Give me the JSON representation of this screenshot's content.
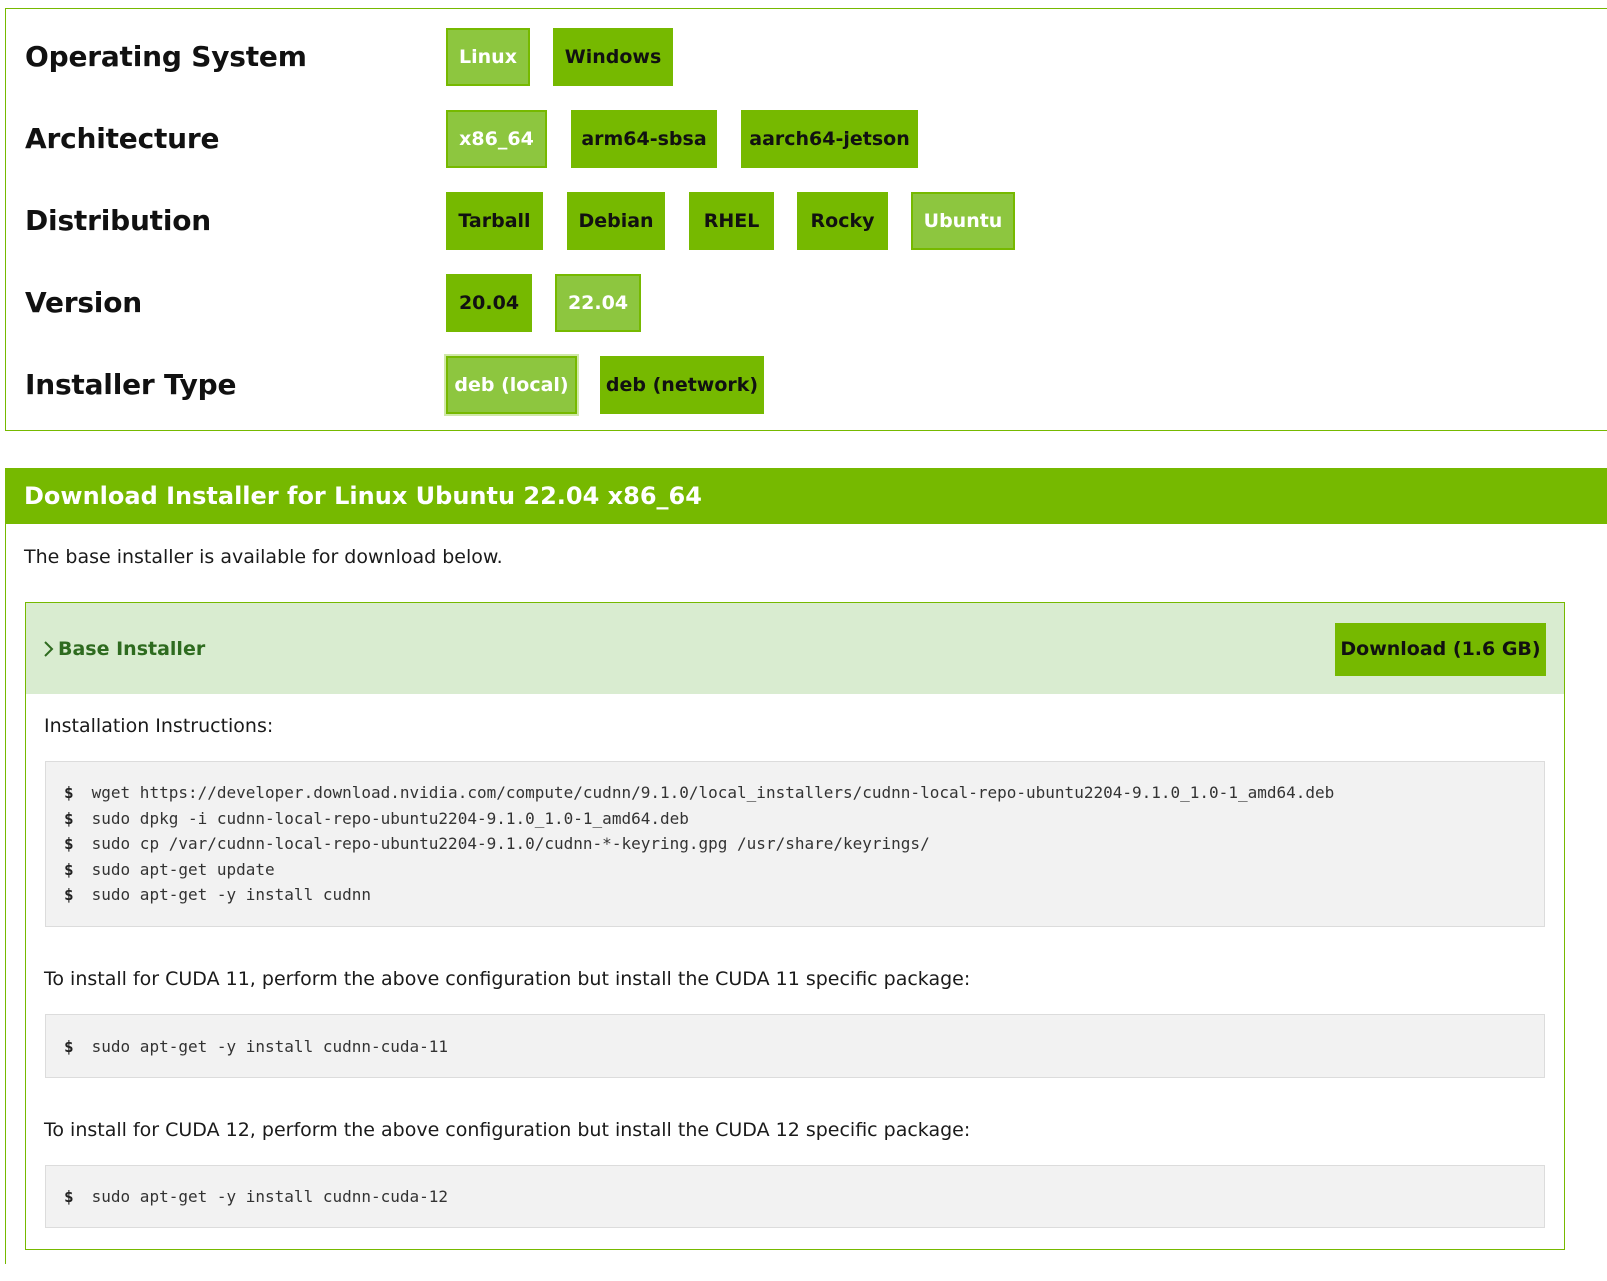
{
  "selector": {
    "rows": [
      {
        "label": "Operating System",
        "options": [
          {
            "label": "Linux",
            "selected": true
          },
          {
            "label": "Windows",
            "selected": false
          }
        ]
      },
      {
        "label": "Architecture",
        "options": [
          {
            "label": "x86_64",
            "selected": true
          },
          {
            "label": "arm64-sbsa",
            "selected": false
          },
          {
            "label": "aarch64-jetson",
            "selected": false
          }
        ]
      },
      {
        "label": "Distribution",
        "options": [
          {
            "label": "Tarball",
            "selected": false
          },
          {
            "label": "Debian",
            "selected": false
          },
          {
            "label": "RHEL",
            "selected": false
          },
          {
            "label": "Rocky",
            "selected": false
          },
          {
            "label": "Ubuntu",
            "selected": true
          }
        ]
      },
      {
        "label": "Version",
        "options": [
          {
            "label": "20.04",
            "selected": false
          },
          {
            "label": "22.04",
            "selected": true
          }
        ]
      },
      {
        "label": "Installer Type",
        "options": [
          {
            "label": "deb (local)",
            "selected": true
          },
          {
            "label": "deb (network)",
            "selected": false
          }
        ]
      }
    ]
  },
  "download": {
    "title": "Download Installer for Linux Ubuntu 22.04 x86_64",
    "intro": "The base installer is available for download below.",
    "installer": {
      "title": "Base Installer",
      "button_label": "Download (1.6 GB)",
      "instructions_label": "Installation Instructions:",
      "prompt": "$",
      "commands": [
        "wget https://developer.download.nvidia.com/compute/cudnn/9.1.0/local_installers/cudnn-local-repo-ubuntu2204-9.1.0_1.0-1_amd64.deb",
        "sudo dpkg -i cudnn-local-repo-ubuntu2204-9.1.0_1.0-1_amd64.deb",
        "sudo cp /var/cudnn-local-repo-ubuntu2204-9.1.0/cudnn-*-keyring.gpg /usr/share/keyrings/",
        "sudo apt-get update",
        "sudo apt-get -y install cudnn"
      ],
      "cuda11_text": "To install for CUDA 11, perform the above configuration but install the CUDA 11 specific package:",
      "cuda11_command": "sudo apt-get -y install cudnn-cuda-11",
      "cuda12_text": "To install for CUDA 12, perform the above configuration but install the CUDA 12 specific package:",
      "cuda12_command": "sudo apt-get -y install cudnn-cuda-12"
    }
  },
  "colors": {
    "accent": "#76b900",
    "selected": "#8dc63f",
    "installer_header_bg": "#d9ecd0",
    "installer_title": "#2e6b1f",
    "code_bg": "#f2f2f2"
  }
}
